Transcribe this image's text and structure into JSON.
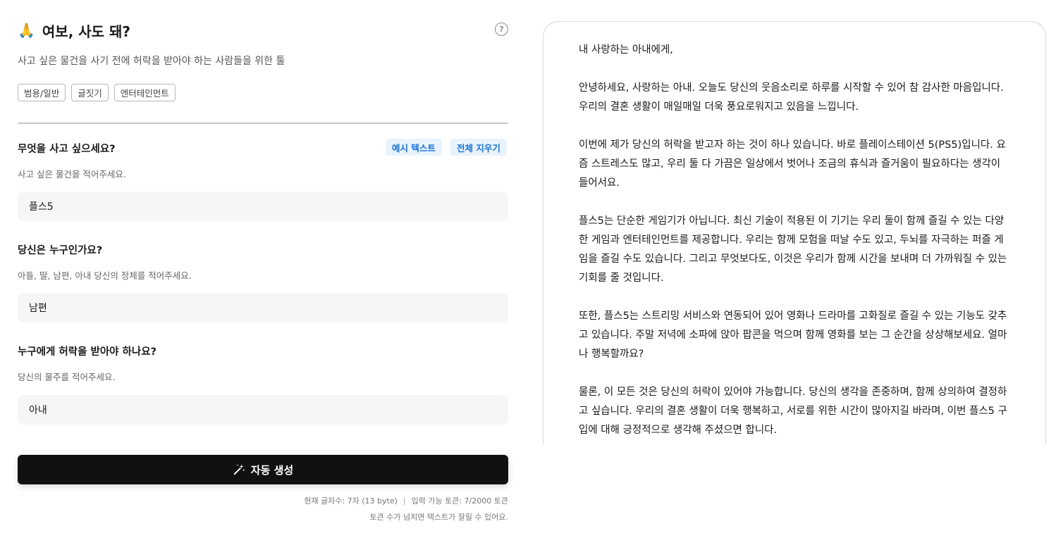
{
  "header": {
    "emoji": "🙏",
    "title": "여보, 사도 돼?",
    "subtitle": "사고 싶은 물건을 사기 전에 허락을 받아야 하는 사람들을 위한 툴",
    "help_icon": "question-circle-icon"
  },
  "tags": [
    "범용/일반",
    "글짓기",
    "엔터테인먼트"
  ],
  "toolbar": {
    "example_label": "예시 텍스트",
    "clear_label": "전체 지우기"
  },
  "fields": [
    {
      "label": "무엇을 사고 싶으세요?",
      "help": "사고 싶은 물건을 적어주세요.",
      "value": "플스5"
    },
    {
      "label": "당신은 누구인가요?",
      "help": "아들, 딸, 남편, 아내 당신의 정체를 적어주세요.",
      "value": "남편"
    },
    {
      "label": "누구에게 허락을 받아야 하나요?",
      "help": "당신의 물주를 적어주세요.",
      "value": "아내"
    }
  ],
  "generate": {
    "label": "자동 생성",
    "icon": "magic-wand-icon"
  },
  "stats": {
    "char_count": "현재 글자수: 7자 (13 byte)",
    "separator": "|",
    "tokens": "입력 가능 토큰: 7/2000 토큰",
    "note": "토큰 수가 넘치면 텍스트가 잘릴 수 있어요."
  },
  "output": {
    "paragraphs": [
      "내 사랑하는 아내에게,",
      "안녕하세요, 사랑하는 아내. 오늘도 당신의 웃음소리로 하루를 시작할 수 있어 참 감사한 마음입니다. 우리의 결혼 생활이 매일매일 더욱 풍요로워지고 있음을 느낍니다.",
      "이번에 제가 당신의 허락을 받고자 하는 것이 하나 있습니다. 바로 플레이스테이션 5(PS5)입니다. 요즘 스트레스도 많고, 우리 둘 다 가끔은 일상에서 벗어나 조금의 휴식과 즐거움이 필요하다는 생각이 들어서요.",
      "플스5는 단순한 게임기가 아닙니다. 최신 기술이 적용된 이 기기는 우리 둘이 함께 즐길 수 있는 다양한 게임과 엔터테인먼트를 제공합니다. 우리는 함께 모험을 떠날 수도 있고, 두뇌를 자극하는 퍼즐 게임을 즐길 수도 있습니다. 그리고 무엇보다도, 이것은 우리가 함께 시간을 보내며 더 가까워질 수 있는 기회를 줄 것입니다.",
      "또한, 플스5는 스트리밍 서비스와 연동되어 있어 영화나 드라마를 고화질로 즐길 수 있는 기능도 갖추고 있습니다. 주말 저녁에 소파에 앉아 팝콘을 먹으며 함께 영화를 보는 그 순간을 상상해보세요. 얼마나 행복할까요?",
      "물론, 이 모든 것은 당신의 허락이 있어야 가능합니다. 당신의 생각을 존중하며, 함께 상의하여 결정하고 싶습니다. 우리의 결혼 생활이 더욱 행복하고, 서로를 위한 시간이 많아지길 바라며, 이번 플스5 구입에 대해 긍정적으로 생각해 주셨으면 합니다."
    ]
  }
}
